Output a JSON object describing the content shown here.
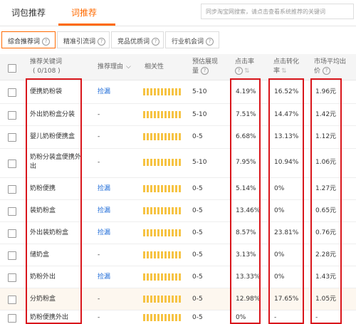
{
  "tabs": [
    "词包推荐",
    "词推荐"
  ],
  "search_placeholder": "同步淘宝网搜索，请点击查看系统推荐的关键词",
  "filters": [
    "综合推荐词",
    "精准引流词",
    "竞品优质词",
    "行业机会词"
  ],
  "columns": {
    "keyword": "推荐关键词",
    "keyword_count": "( 0/108 )",
    "reason": "推荐理由",
    "relevance": "相关性",
    "est_impr_1": "预估展现",
    "est_impr_2": "量",
    "ctr": "点击率",
    "cvr_1": "点击转化",
    "cvr_2": "率",
    "avg_price_1": "市场平均出",
    "avg_price_2": "价"
  },
  "rows": [
    {
      "kw1": "便携奶粉袋",
      "kw2": "",
      "reason": "捡漏",
      "impr": "5-10",
      "ctr": "4.19%",
      "cvr": "16.52%",
      "price": "1.96元"
    },
    {
      "kw1": "外出奶粉盒分装",
      "kw2": "",
      "reason": "-",
      "impr": "5-10",
      "ctr": "7.51%",
      "cvr": "14.47%",
      "price": "1.42元"
    },
    {
      "kw1": "婴儿奶粉便携盒",
      "kw2": "",
      "reason": "-",
      "impr": "0-5",
      "ctr": "6.68%",
      "cvr": "13.13%",
      "price": "1.12元"
    },
    {
      "kw1": "奶粉分装盒便携外",
      "kw2": "出",
      "reason": "-",
      "impr": "5-10",
      "ctr": "7.95%",
      "cvr": "10.94%",
      "price": "1.06元"
    },
    {
      "kw1": "奶粉便携",
      "kw2": "",
      "reason": "捡漏",
      "impr": "0-5",
      "ctr": "5.14%",
      "cvr": "0%",
      "price": "1.27元"
    },
    {
      "kw1": "装奶粉盒",
      "kw2": "",
      "reason": "捡漏",
      "impr": "0-5",
      "ctr": "13.46%",
      "cvr": "0%",
      "price": "0.65元"
    },
    {
      "kw1": "外出装奶粉盒",
      "kw2": "",
      "reason": "捡漏",
      "impr": "0-5",
      "ctr": "8.57%",
      "cvr": "23.81%",
      "price": "0.76元"
    },
    {
      "kw1": "储奶盒",
      "kw2": "",
      "reason": "-",
      "impr": "0-5",
      "ctr": "3.13%",
      "cvr": "0%",
      "price": "2.28元"
    },
    {
      "kw1": "奶粉外出",
      "kw2": "",
      "reason": "捡漏",
      "impr": "0-5",
      "ctr": "13.33%",
      "cvr": "0%",
      "price": "1.43元"
    },
    {
      "kw1": "分奶粉盒",
      "kw2": "",
      "reason": "-",
      "impr": "0-5",
      "ctr": "12.98%",
      "cvr": "17.65%",
      "price": "1.05元"
    },
    {
      "kw1": "奶粉便携外出",
      "kw2": "",
      "reason": "-",
      "impr": "0-5",
      "ctr": "0%",
      "cvr": "-",
      "price": "-"
    }
  ],
  "colors": {
    "accent": "#ff6a00",
    "link": "#1f6cd8",
    "highlight_box": "#d9161c",
    "relevance_bar": "#f6c343"
  },
  "icons": [
    "help-circle-icon",
    "chevron-down-icon",
    "sort-icon"
  ]
}
